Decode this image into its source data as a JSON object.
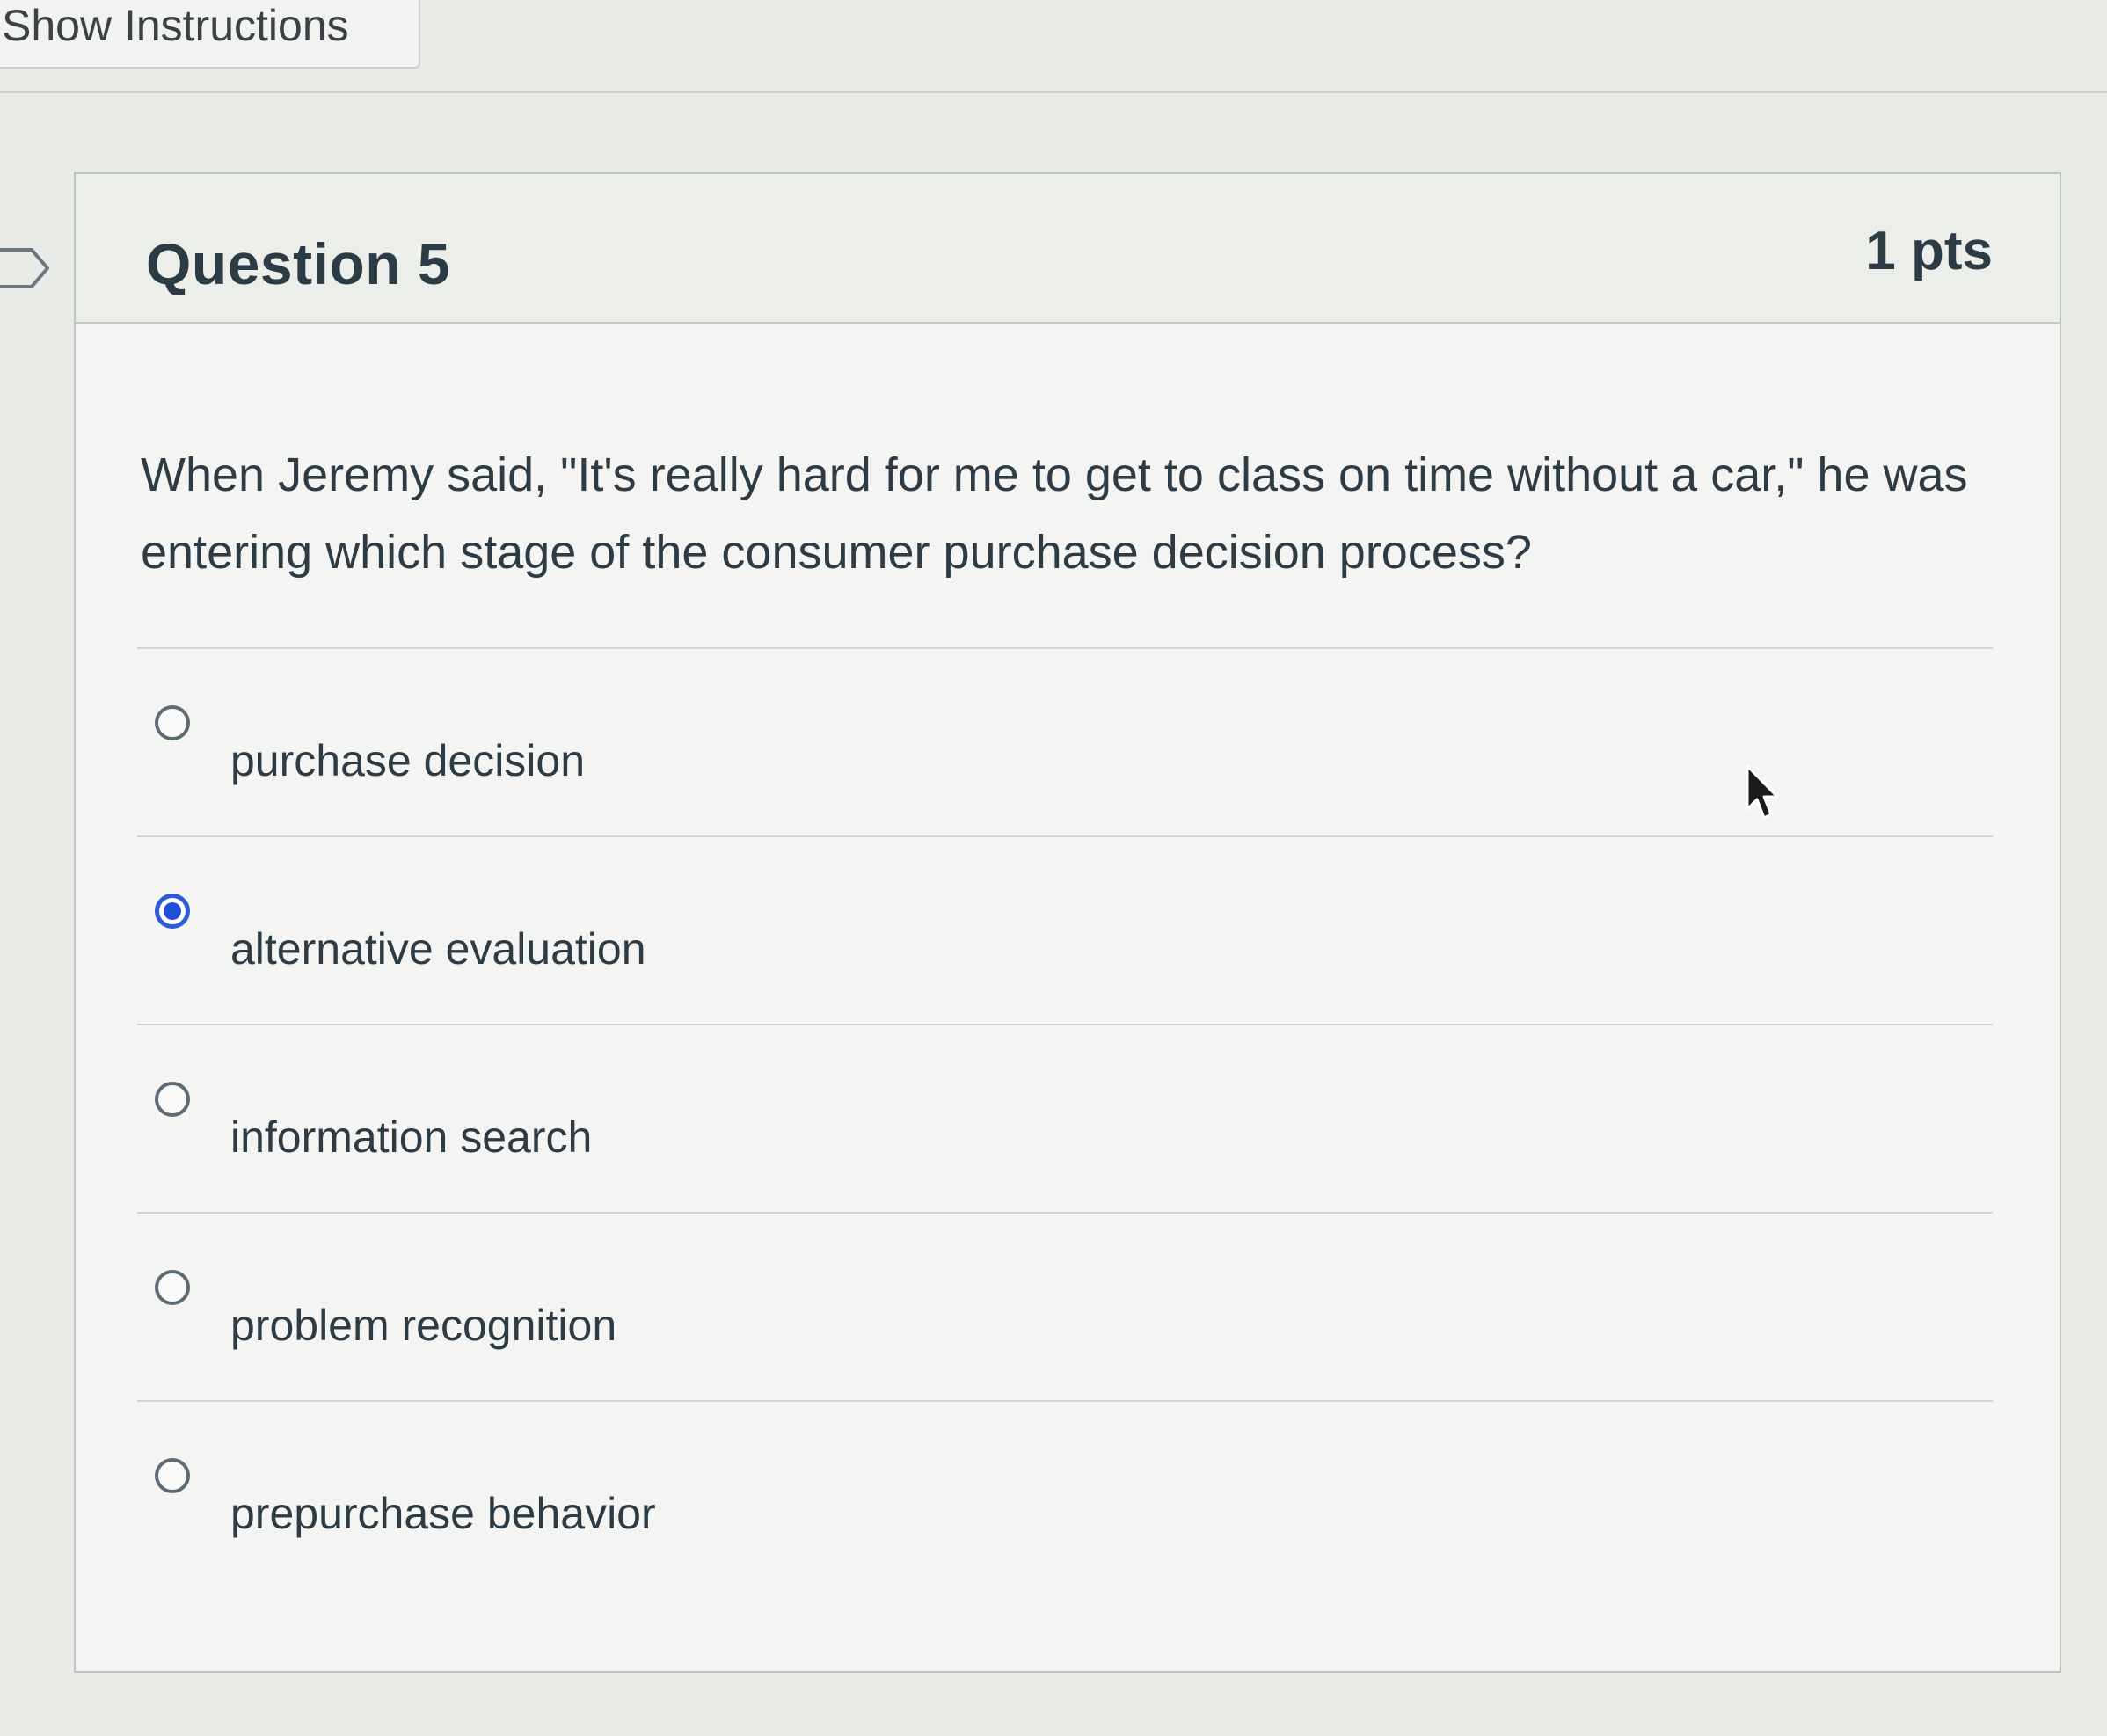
{
  "toolbar": {
    "show_instructions_label": "Show Instructions"
  },
  "question": {
    "title": "Question 5",
    "points": "1 pts",
    "text": "When Jeremy said, \"It's really hard for me to get to class on time without a car,\" he was entering which stage of the consumer purchase decision process?"
  },
  "answers": [
    {
      "label": "purchase decision",
      "selected": false
    },
    {
      "label": "alternative evaluation",
      "selected": true
    },
    {
      "label": "information search",
      "selected": false
    },
    {
      "label": "problem recognition",
      "selected": false
    },
    {
      "label": "prepurchase behavior",
      "selected": false
    }
  ],
  "colors": {
    "accent": "#1f4ed8",
    "text": "#2d3b45",
    "border": "#bfc4c5"
  }
}
